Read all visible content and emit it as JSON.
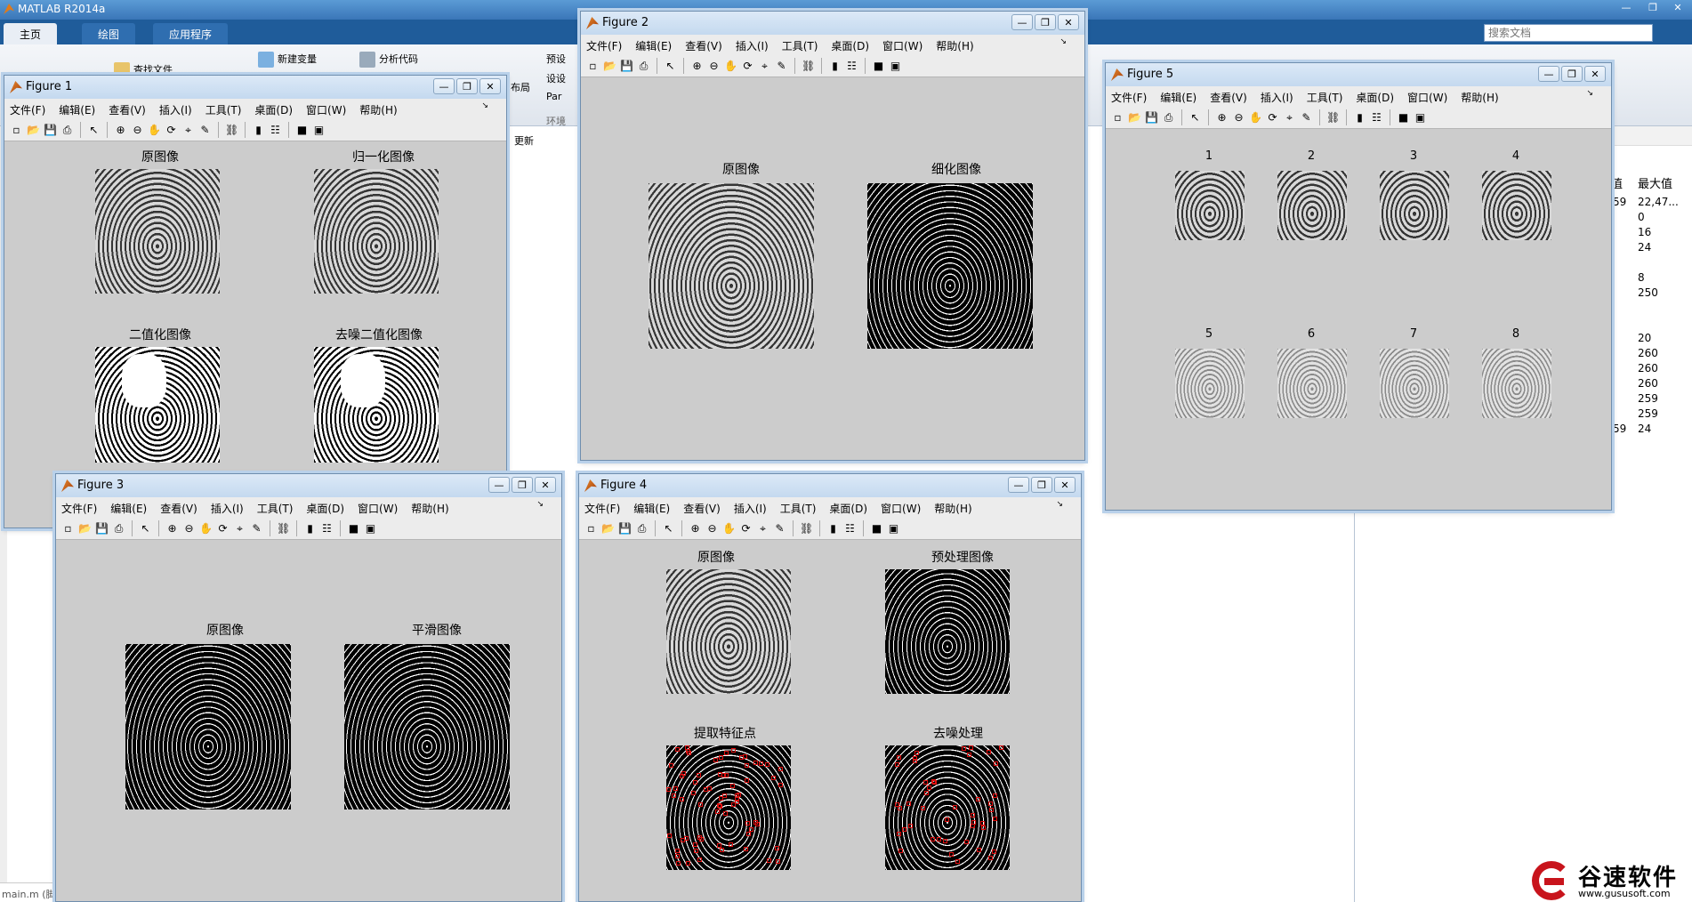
{
  "main": {
    "title": "MATLAB R2014a",
    "tabs": [
      "主页",
      "绘图",
      "应用程序"
    ],
    "search_placeholder": "搜索文档",
    "ribbon": {
      "find_files": "查找文件",
      "new_var": "新建变量",
      "analyze_code": "分析代码",
      "layout": "布局",
      "prefs": "预设",
      "set_path": "设设",
      "parallel": "Par",
      "env": "环境",
      "update": "更新"
    },
    "statusbar": "main.m (脚"
  },
  "workspace": {
    "col_header": "最大值",
    "col_header_prev": "值",
    "values": [
      "22,47...",
      "0",
      "16",
      "24",
      "",
      "8",
      "250",
      "",
      "",
      "20",
      "260",
      "260",
      "260",
      "259",
      "259",
      "24"
    ],
    "prev_values": [
      "59",
      "",
      "",
      "",
      "",
      "",
      "",
      "",
      "",
      "",
      "",
      "",
      "",
      "",
      "",
      "59"
    ]
  },
  "fig_menu": [
    "文件(F)",
    "编辑(E)",
    "查看(V)",
    "插入(I)",
    "工具(T)",
    "桌面(D)",
    "窗口(W)",
    "帮助(H)"
  ],
  "figures": {
    "f1": {
      "title": "Figure 1",
      "p1": "原图像",
      "p2": "归一化图像",
      "p3": "二值化图像",
      "p4": "去噪二值化图像"
    },
    "f2": {
      "title": "Figure 2",
      "p1": "原图像",
      "p2": "细化图像"
    },
    "f3": {
      "title": "Figure 3",
      "p1": "原图像",
      "p2": "平滑图像"
    },
    "f4": {
      "title": "Figure 4",
      "p1": "原图像",
      "p2": "预处理图像",
      "p3": "提取特征点",
      "p4": "去噪处理"
    },
    "f5": {
      "title": "Figure 5",
      "labels": [
        "1",
        "2",
        "3",
        "4",
        "5",
        "6",
        "7",
        "8"
      ]
    }
  },
  "watermark": {
    "text": "谷速软件",
    "url": "www.gususoft.com"
  }
}
